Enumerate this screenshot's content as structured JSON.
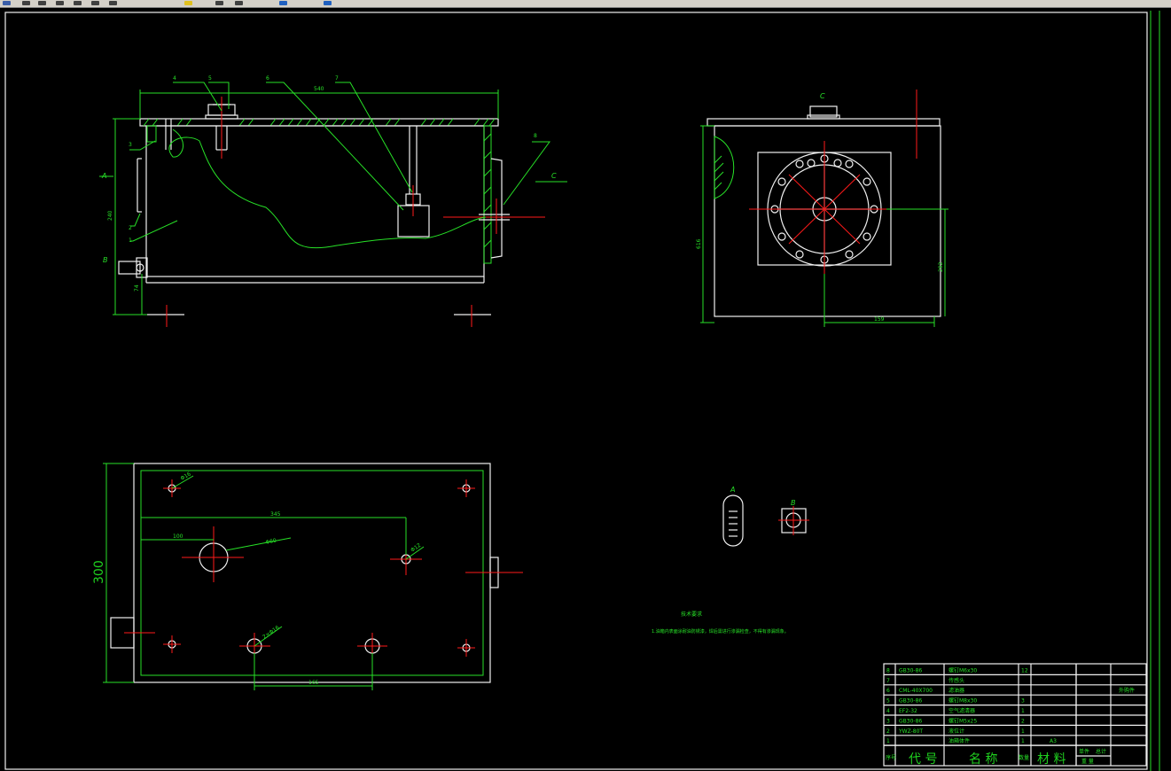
{
  "toolbar": {
    "buttons": [
      {
        "name": "window-icon",
        "color": "#3a5ea8"
      },
      {
        "name": "pan-icon",
        "color": "#404040"
      },
      {
        "name": "zoom-realtime-icon",
        "color": "#404040"
      },
      {
        "name": "zoom-window-icon",
        "color": "#404040"
      },
      {
        "name": "zoom-previous-icon",
        "color": "#404040"
      },
      {
        "name": "undo-icon",
        "color": "#404040"
      },
      {
        "name": "redo-icon",
        "color": "#404040"
      },
      {
        "name": "properties-icon",
        "color": "#e0c020"
      },
      {
        "name": "design-center-icon",
        "color": "#404040"
      },
      {
        "name": "tool-palette-icon",
        "color": "#404040"
      },
      {
        "name": "markup-icon",
        "color": "#2060c0"
      },
      {
        "name": "help-icon",
        "color": "#2060c0"
      }
    ]
  },
  "front_view": {
    "width_dim": "540",
    "height_dim": "240",
    "base_dim": "74",
    "leaders": [
      "4",
      "5",
      "6",
      "7",
      "3",
      "2",
      "1",
      "8"
    ],
    "section_labels": {
      "a": "A",
      "b": "B",
      "c": "C"
    }
  },
  "side_view": {
    "view_label": "C",
    "height_dim": "616",
    "flange_height_dim": "292",
    "offset_dim": "159"
  },
  "top_view": {
    "height_dim": "300",
    "dim_345": "345",
    "dim_100": "100",
    "dim_165": "165",
    "dia_big": "Φ60",
    "dia_right": "Φ12",
    "dia_top": "Φ16",
    "dia_bottom": "2×Φ16"
  },
  "details": {
    "a": "A",
    "b": "B"
  },
  "notes": {
    "title": "技术要求",
    "line1": "1.油箱内表面涂耐油防锈漆，焊后需进行渗漏检查，不得有渗漏现象。"
  },
  "title_block": {
    "rows": [
      {
        "no": "8",
        "code": "GB30-86",
        "name": "螺钉M6x30",
        "qty": "12",
        "note": ""
      },
      {
        "no": "7",
        "code": "",
        "name": "传感头",
        "qty": "",
        "note": ""
      },
      {
        "no": "6",
        "code": "CML-40X700",
        "name": "滤油器",
        "qty": "",
        "note": "外购件"
      },
      {
        "no": "5",
        "code": "GB30-86",
        "name": "螺钉M8x30",
        "qty": "3",
        "note": ""
      },
      {
        "no": "4",
        "code": "EF2-32",
        "name": "空气滤清器",
        "qty": "1",
        "note": ""
      },
      {
        "no": "3",
        "code": "GB30-86",
        "name": "螺钉M5x25",
        "qty": "2",
        "note": ""
      },
      {
        "no": "2",
        "code": "YWZ-80T",
        "name": "液位计",
        "qty": "1",
        "note": ""
      },
      {
        "no": "1",
        "code": "",
        "name": "油箱体件",
        "qty": "1",
        "note": "A3"
      }
    ],
    "header": {
      "seq": "序号",
      "code": "代 号",
      "name": "名 称",
      "qty": "数量",
      "material": "材 料",
      "unit_w": "单件",
      "total": "总计",
      "weight": "重 量",
      "remark": "备 注"
    }
  }
}
